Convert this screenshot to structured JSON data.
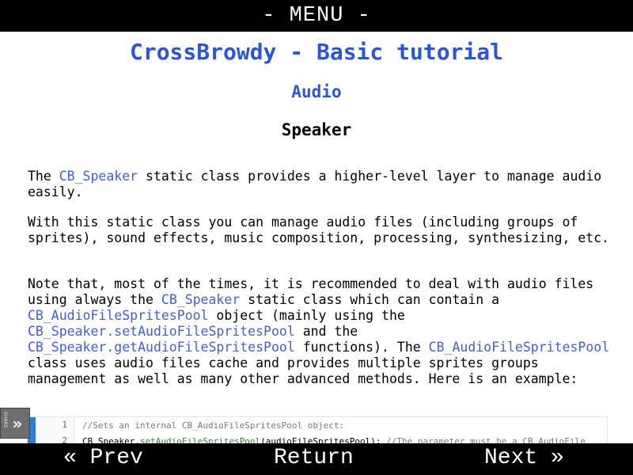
{
  "header": {
    "menu_label": "- MENU -"
  },
  "page": {
    "title": "CrossBrowdy - Basic tutorial",
    "section": "Audio",
    "subsection": "Speaker"
  },
  "paragraphs": {
    "p1": {
      "t1": "The ",
      "l1": "CB_Speaker",
      "t2": " static class provides a higher-level layer to manage audio easily."
    },
    "p2": {
      "text": "With this static class you can manage audio files (including groups of sprites), sound effects, music composition, processing, synthesizing, etc."
    },
    "p3": {
      "t1": "Note that, most of the times, it is recommended to deal with audio files using always the ",
      "l1": "CB_Speaker",
      "t2": " static class which can contain a ",
      "l2": "CB_AudioFileSpritesPool",
      "t3": " object (mainly using the ",
      "l3": "CB_Speaker.setAudioFileSpritesPool",
      "t4": " and the ",
      "l4": "CB_Speaker.getAudioFileSpritesPool",
      "t5": " functions). The ",
      "l5": "CB_AudioFileSpritesPool",
      "t6": " class uses audio files cache and provides multiple sprites groups management as well as many other advanced methods. Here is an example:"
    }
  },
  "code": {
    "lines": [
      {
        "num": "1",
        "comment": "//Sets an internal CB_AudioFileSpritesPool object:"
      },
      {
        "num": "2",
        "obj": "CB_Speaker.",
        "fn": "setAudioFileSpritesPool",
        "args": "(audioFileSpritesPool); ",
        "comment": "//The parameter must be a CB_AudioFile"
      }
    ]
  },
  "share": {
    "label": "SHARE",
    "icon": "chevron-right-double-icon"
  },
  "footer": {
    "prev_label": "« Prev",
    "return_label": "Return",
    "next_label": "Next »"
  },
  "colors": {
    "heading_blue": "#2b53e2",
    "link_blue": "#3d5fe0",
    "bar_black": "#000000",
    "code_accent": "#2f7fd4"
  }
}
